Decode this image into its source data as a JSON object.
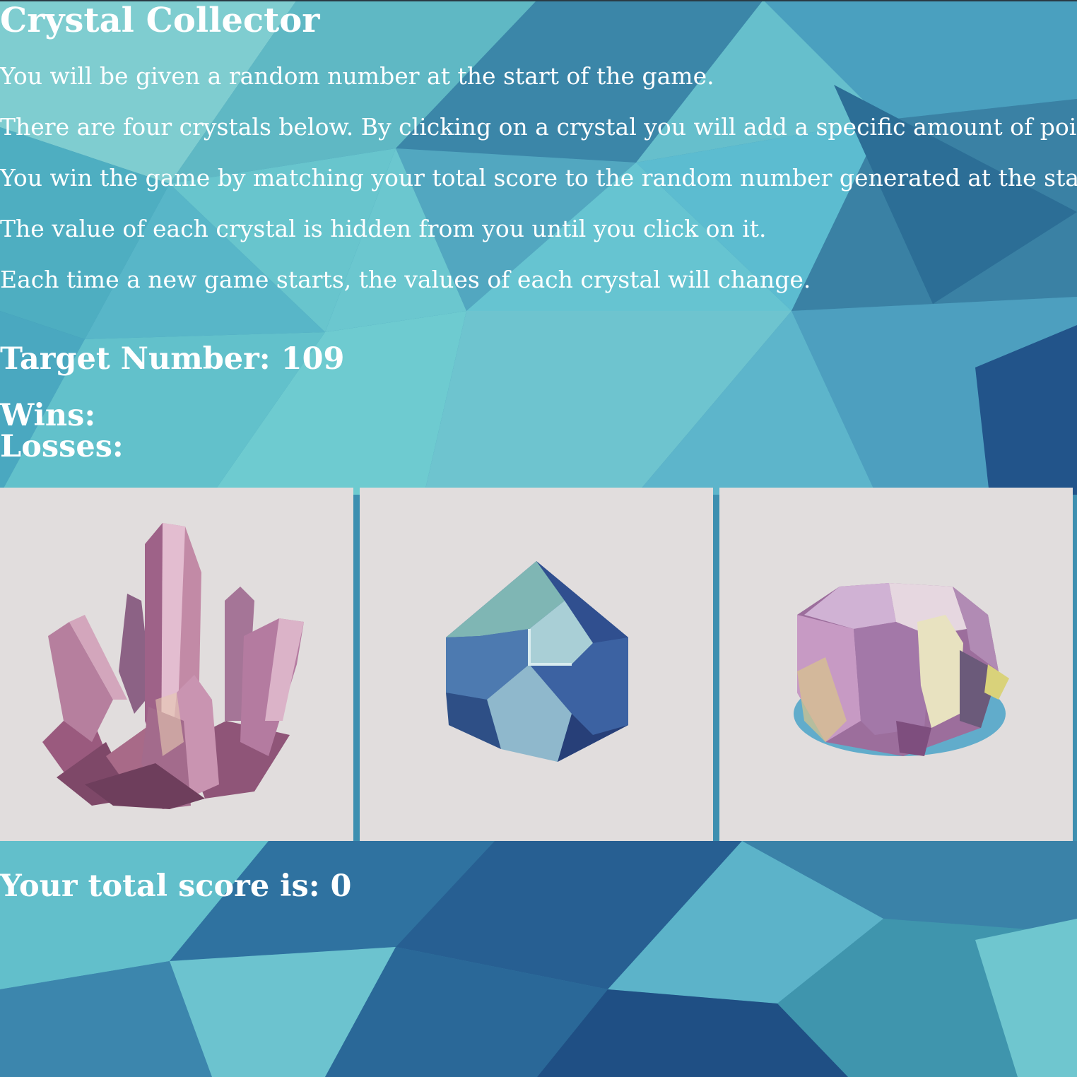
{
  "title": "Crystal Collector",
  "instructions": [
    "You will be given a random number at the start of the game.",
    "There are four crystals below. By clicking on a crystal you will add a specific amount of points to your total score.",
    "You win the game by matching your total score to the random number generated at the start of the game.",
    "The value of each crystal is hidden from you until you click on it.",
    "Each time a new game starts, the values of each crystal will change."
  ],
  "target": {
    "label": "Target Number: 109"
  },
  "wins": {
    "label": "Wins:"
  },
  "losses": {
    "label": "Losses:"
  },
  "score": {
    "label": "Your total score is: 0"
  },
  "crystals": [
    {
      "icon": "pink-crystal-cluster-icon"
    },
    {
      "icon": "blue-crystal-icon"
    },
    {
      "icon": "purple-crystal-chunk-icon"
    }
  ],
  "colors": {
    "background_light": "#6cc9cc",
    "background_dark": "#1e4e86",
    "tile": "#e1dddd",
    "text": "#ffffff"
  }
}
